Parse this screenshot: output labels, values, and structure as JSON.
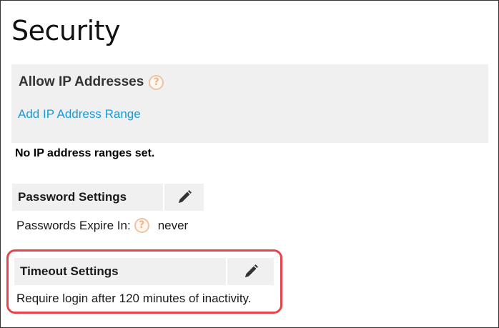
{
  "page": {
    "title": "Security"
  },
  "allow_ip": {
    "heading": "Allow IP Addresses",
    "help_icon_glyph": "?",
    "add_link": "Add IP Address Range",
    "empty_message": "No IP address ranges set."
  },
  "password_settings": {
    "heading": "Password Settings",
    "expire_label": "Passwords Expire In:",
    "help_icon_glyph": "?",
    "expire_value": "never"
  },
  "timeout_settings": {
    "heading": "Timeout Settings",
    "description": "Require login after 120 minutes of inactivity."
  },
  "icons": {
    "help": "question-circle-icon",
    "edit": "pencil-icon"
  },
  "colors": {
    "link": "#1a9bd7",
    "highlight_border": "#e8434a",
    "panel_bg": "#f0f0f0",
    "help_icon": "#f0b48a"
  }
}
